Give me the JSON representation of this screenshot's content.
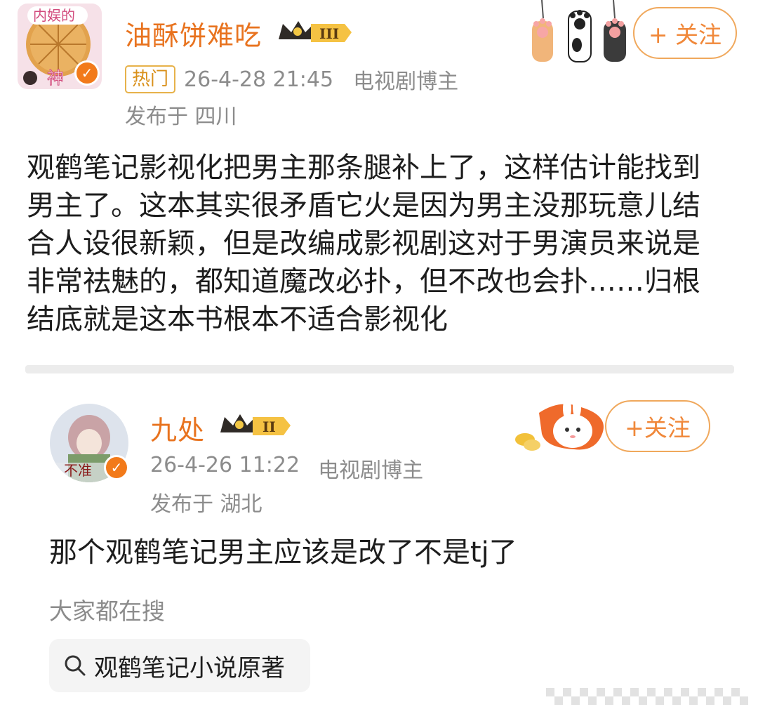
{
  "post1": {
    "avatar_text_top": "内娱的",
    "avatar_text_bottom": "神",
    "username": "油酥饼难吃",
    "level": "III",
    "hot_tag": "热门",
    "timestamp": "26-4-28 21:45",
    "role": "电视剧博主",
    "location": "发布于 四川",
    "follow_label": "+ 关注",
    "body": "观鹤笔记影视化把男主那条腿补上了，这样估计能找到男主了。这本其实很矛盾它火是因为男主没那玩意儿结合人设很新颖，但是改编成影视剧这对于男演员来说是非常祛魅的，都知道魔改必扑，但不改也会扑……归根结底就是这本书根本不适合影视化"
  },
  "post2": {
    "avatar_text": "不准",
    "username": "九处",
    "level": "II",
    "timestamp": "26-4-26 11:22",
    "role": "电视剧博主",
    "location": "发布于 湖北",
    "follow_label": "+关注",
    "body": "那个观鹤笔记男主应该是改了不是tj了"
  },
  "search": {
    "heading": "大家都在搜",
    "query": "观鹤笔记小说原著"
  },
  "colors": {
    "accent": "#e8731f",
    "meta": "#8c8c8c",
    "hot_tag": "#e7b24a"
  }
}
